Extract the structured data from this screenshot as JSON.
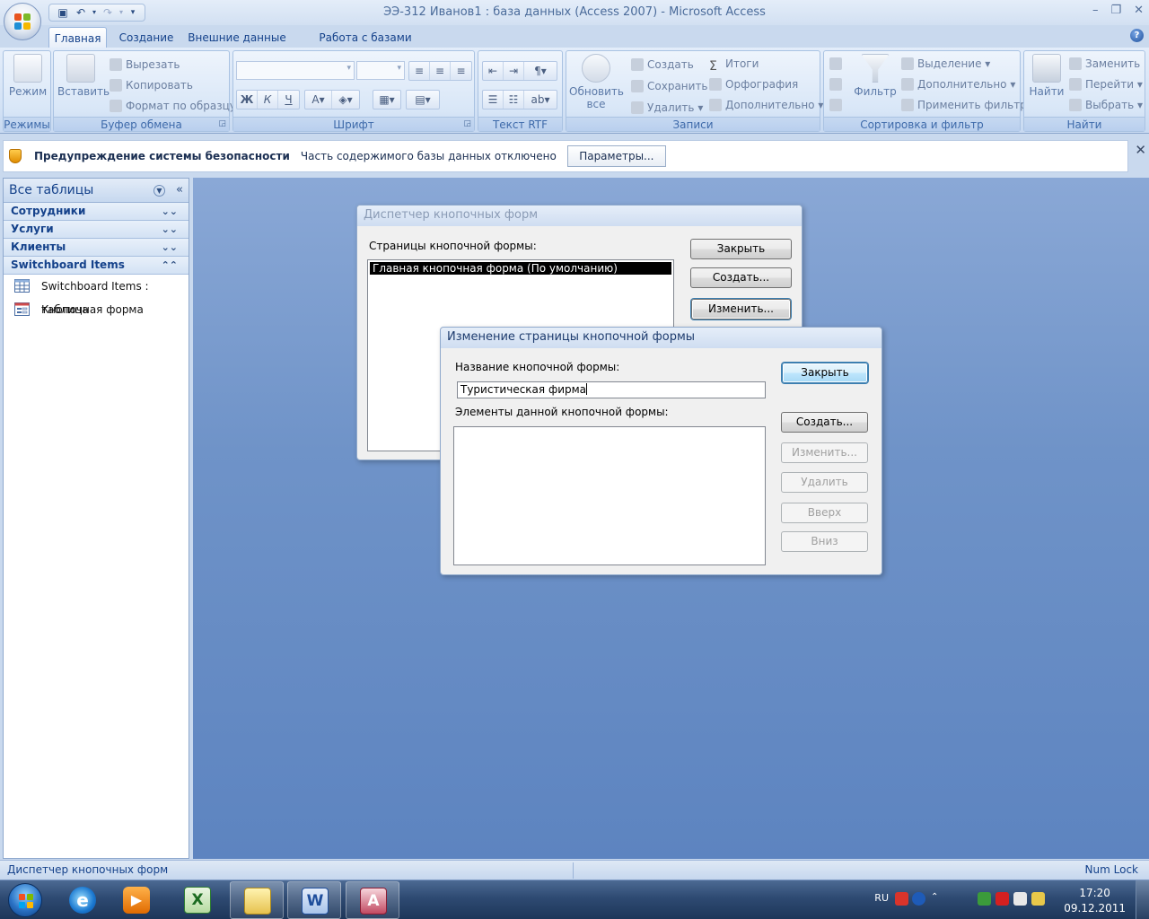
{
  "window": {
    "title": "ЭЭ-312 Иванов1 : база данных (Access 2007) - Microsoft Access"
  },
  "tabs": [
    {
      "label": "Главная",
      "active": true
    },
    {
      "label": "Создание"
    },
    {
      "label": "Внешние данные"
    },
    {
      "label": "Работа с базами данных"
    }
  ],
  "ribbon": {
    "groups": {
      "modes": "Режимы",
      "clipboard": "Буфер обмена",
      "font": "Шрифт",
      "rtf": "Текст RTF",
      "records": "Записи",
      "sort_filter": "Сортировка и фильтр",
      "find": "Найти"
    },
    "mode_btn": "Режим",
    "paste_btn": "Вставить",
    "cut": "Вырезать",
    "copy": "Копировать",
    "format_painter": "Формат по образцу",
    "font_bold": "Ж",
    "font_italic": "К",
    "font_underline": "Ч",
    "refresh_line1": "Обновить",
    "refresh_line2": "все",
    "create": "Создать",
    "save": "Сохранить",
    "delete": "Удалить",
    "totals": "Итоги",
    "spelling": "Орфография",
    "more": "Дополнительно",
    "filter": "Фильтр",
    "selection": "Выделение",
    "advanced": "Дополнительно",
    "apply_filter": "Применить фильтр",
    "find_btn": "Найти",
    "replace": "Заменить",
    "goto": "Перейти",
    "select": "Выбрать"
  },
  "security": {
    "title": "Предупреждение системы безопасности",
    "text": "Часть содержимого базы данных отключено",
    "button": "Параметры..."
  },
  "nav": {
    "title": "Все таблицы",
    "groups": [
      {
        "label": "Сотрудники",
        "expanded": false
      },
      {
        "label": "Услуги",
        "expanded": false
      },
      {
        "label": "Клиенты",
        "expanded": false
      },
      {
        "label": "Switchboard Items",
        "expanded": true
      }
    ],
    "items": [
      {
        "label": "Switchboard Items : таблица",
        "icon": "table-icon"
      },
      {
        "label": "Кнопочная форма",
        "icon": "form-icon"
      }
    ]
  },
  "manager_dialog": {
    "title": "Диспетчер кнопочных форм",
    "pages_label": "Страницы кнопочной формы:",
    "pages": [
      "Главная кнопочная форма (По умолчанию)"
    ],
    "close": "Закрыть",
    "create": "Создать...",
    "edit": "Изменить..."
  },
  "edit_dialog": {
    "title": "Изменение страницы кнопочной формы",
    "name_label": "Название кнопочной формы:",
    "name_value": "Туристическая фирма",
    "items_label": "Элементы данной кнопочной формы:",
    "close": "Закрыть",
    "create": "Создать...",
    "edit": "Изменить...",
    "delete": "Удалить",
    "up": "Вверх",
    "down": "Вниз"
  },
  "status": {
    "left": "Диспетчер кнопочных форм",
    "right": "Num Lock"
  },
  "taskbar": {
    "lang": "RU",
    "time": "17:20",
    "date": "09.12.2011",
    "apps": [
      "internet-explorer-icon",
      "media-player-icon",
      "excel-icon",
      "explorer-folder-icon",
      "word-icon",
      "access-icon"
    ]
  },
  "colors": {
    "ribbon_text": "#15428b",
    "workarea": "#6f93c8",
    "selection": "#000000"
  }
}
